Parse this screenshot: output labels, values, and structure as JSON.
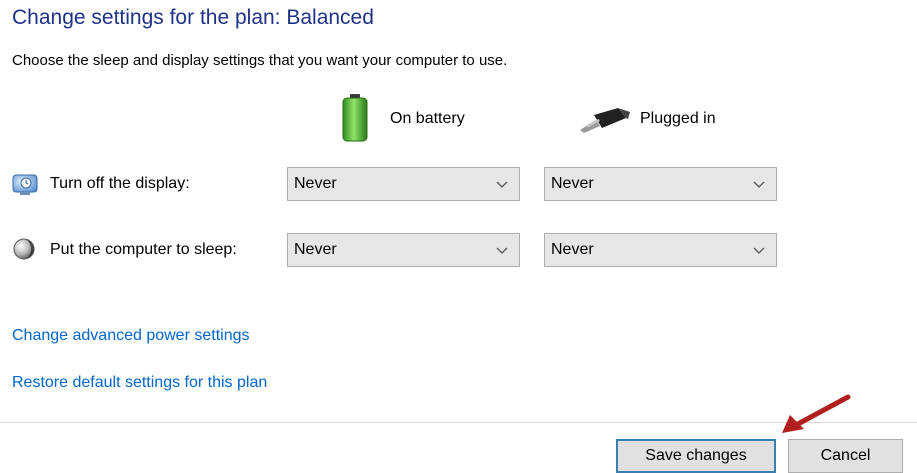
{
  "page": {
    "title": "Change settings for the plan: Balanced",
    "subtitle": "Choose the sleep and display settings that you want your computer to use."
  },
  "columns": {
    "battery_label": "On battery",
    "battery_icon": "battery-icon",
    "plugged_label": "Plugged in",
    "plugged_icon": "power-plug-icon"
  },
  "settings": {
    "display": {
      "label": "Turn off the display:",
      "icon": "display-icon",
      "on_battery": "Never",
      "plugged_in": "Never"
    },
    "sleep": {
      "label": "Put the computer to sleep:",
      "icon": "moon-icon",
      "on_battery": "Never",
      "plugged_in": "Never"
    }
  },
  "links": {
    "advanced": "Change advanced power settings",
    "restore": "Restore default settings for this plan"
  },
  "buttons": {
    "save": "Save changes",
    "cancel": "Cancel"
  },
  "colors": {
    "title": "#1e3287",
    "link": "#0066cc",
    "primary_border": "#3c7fb1",
    "arrow": "#b01e1e"
  }
}
